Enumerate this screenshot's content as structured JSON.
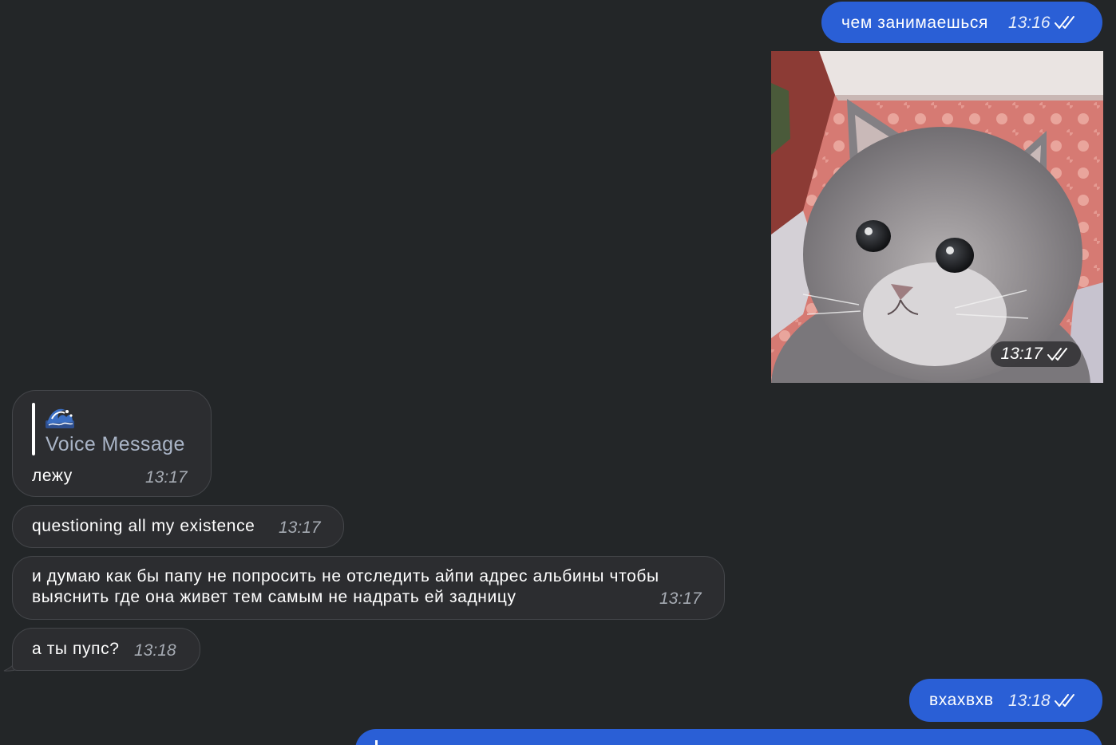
{
  "chat": {
    "messages": [
      {
        "direction": "outgoing",
        "text": "чем занимаешься",
        "time": "13:16",
        "status": "read"
      },
      {
        "direction": "outgoing",
        "type": "photo",
        "image": "gray fluffy kitten against red patterned wallpaper",
        "time": "13:17",
        "status": "read"
      },
      {
        "direction": "incoming",
        "reply_to": {
          "icon": "wave-emoji",
          "label": "Voice Message"
        },
        "text": "лежу",
        "time": "13:17"
      },
      {
        "direction": "incoming",
        "text": "questioning all my existence",
        "time": "13:17"
      },
      {
        "direction": "incoming",
        "text_line1": "и думаю как бы папу не попросить не отследить айпи адрес альбины чтобы",
        "text_line2": "выяснить где она живет тем самым не надрать ей задницу",
        "time": "13:17"
      },
      {
        "direction": "incoming",
        "text": "а ты пупс?",
        "time": "13:18"
      },
      {
        "direction": "outgoing",
        "text": "вхахвхв",
        "time": "13:18",
        "status": "read"
      },
      {
        "direction": "outgoing",
        "text": "",
        "status": "partially visible"
      }
    ]
  },
  "colors": {
    "background": "#232628",
    "outgoing_bubble": "#2a5fd6",
    "incoming_bubble": "#2c2d30",
    "incoming_border": "#44464a",
    "reply_label": "#a9b4c6",
    "incoming_time": "#a6abb3"
  },
  "icons": {
    "read_receipt": "double-check-icon",
    "reply_icon": "wave-emoji-icon"
  }
}
